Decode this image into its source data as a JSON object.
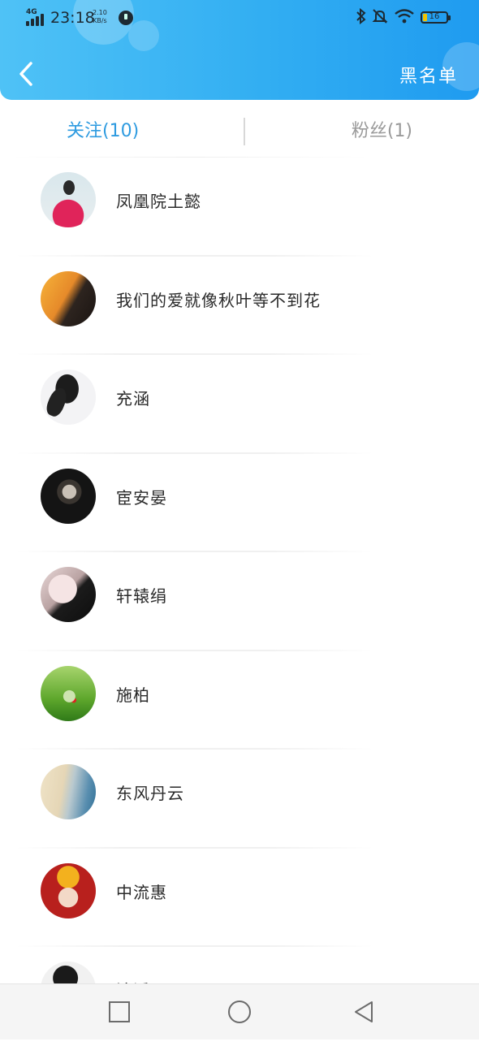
{
  "status_bar": {
    "network": "4G",
    "time": "23:18",
    "speed_value": "2.10",
    "speed_unit": "KB/s",
    "battery": "16"
  },
  "header": {
    "back_icon": "chevron-left-icon",
    "right_action": "黑名单"
  },
  "tabs": [
    {
      "label": "关注(10)",
      "active": true
    },
    {
      "label": "粉丝(1)",
      "active": false
    }
  ],
  "users": [
    {
      "name": "凤凰院土懿"
    },
    {
      "name": "我们的爱就像秋叶等不到花"
    },
    {
      "name": "充涵"
    },
    {
      "name": "宦安晏"
    },
    {
      "name": "轩辕绢"
    },
    {
      "name": "施柏"
    },
    {
      "name": "东风丹云"
    },
    {
      "name": "中流惠"
    },
    {
      "name": "淦溪"
    }
  ],
  "nav": {
    "recent_icon": "square-icon",
    "home_icon": "circle-icon",
    "back_icon": "triangle-back-icon"
  },
  "colors": {
    "header_start": "#4fc2f6",
    "header_end": "#1f9bf0",
    "tab_active": "#2e9be0",
    "tab_inactive": "#9a9a9a"
  }
}
